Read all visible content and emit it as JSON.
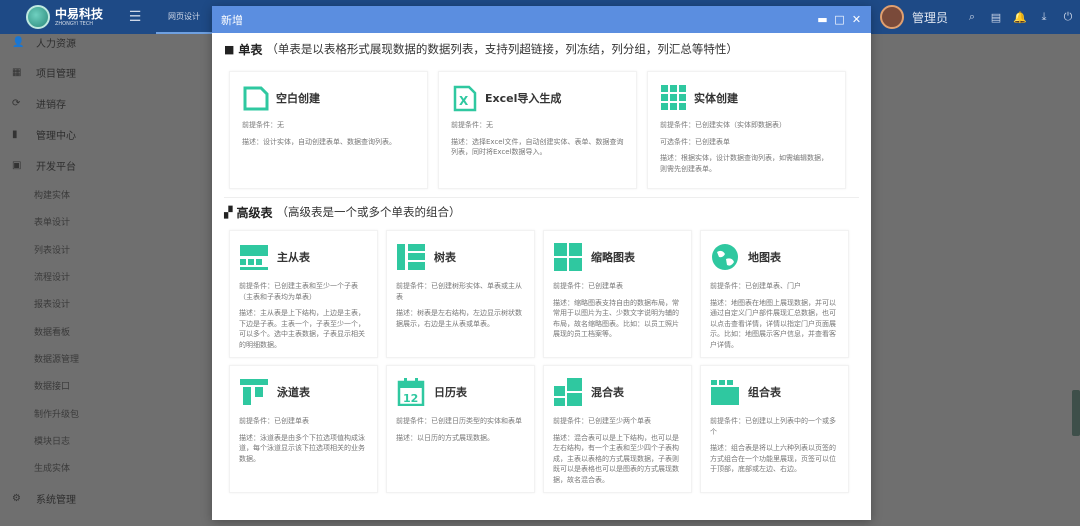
{
  "app": {
    "logo_cn": "中易科技",
    "logo_en": "ZHONGYI TECH",
    "top_tab": "网页设计",
    "username": "管理员"
  },
  "sidebar": {
    "items": [
      {
        "label": "人力资源",
        "icon": "user-icon"
      },
      {
        "label": "项目管理",
        "icon": "calendar-icon"
      },
      {
        "label": "进销存",
        "icon": "refresh-icon"
      },
      {
        "label": "管理中心",
        "icon": "chart-icon"
      },
      {
        "label": "开发平台",
        "icon": "grid-icon"
      }
    ],
    "sub_items": [
      "构建实体",
      "表单设计",
      "列表设计",
      "流程设计",
      "报表设计",
      "数据看板",
      "数据源管理",
      "数据接口",
      "制作升级包",
      "模块日志",
      "生成实体"
    ],
    "bottom_item": {
      "label": "系统管理",
      "icon": "settings-icon"
    }
  },
  "modal": {
    "title": "新增",
    "single_section": {
      "name": "单表",
      "desc": "（单表是以表格形式展现数据的数据列表，支持列超链接，列冻结，列分组，列汇总等特性）",
      "cards": [
        {
          "title": "空白创建",
          "icon": "blank-doc-icon",
          "color": "#2fc8a0",
          "line1": "前提条件：无",
          "line2": "描述：设计实体，自动创建表单、数据查询列表。"
        },
        {
          "title": "Excel导入生成",
          "icon": "excel-icon",
          "color": "#2fc8a0",
          "line1": "前提条件：无",
          "line2": "描述：选择Excel文件，自动创建实体、表单、数据查询列表，同时将Excel数据导入。"
        },
        {
          "title": "实体创建",
          "icon": "table-grid-icon",
          "color": "#2fc8a0",
          "line1": "前提条件：已创建实体（实体即数据表）",
          "line2": "可选条件：已创建表单",
          "line3": "描述：根据实体，设计数据查询列表，如需编辑数据，则需先创建表单。"
        }
      ]
    },
    "advanced_section": {
      "name": "高级表",
      "desc": "（高级表是一个或多个单表的组合）",
      "cards": [
        {
          "title": "主从表",
          "icon": "master-detail-icon",
          "line1": "前提条件：已创建主表和至少一个子表（主表和子表均为单表）",
          "line2": "描述：主从表是上下结构，上边是主表，下边是子表。主表一个，子表至少一个，可以多个。选中主表数据，子表显示相关的明细数据。"
        },
        {
          "title": "树表",
          "icon": "tree-table-icon",
          "line1": "前提条件：已创建树形实体、单表或主从表",
          "line2": "描述：树表是左右结构，左边显示树状数据展示，右边是主从表或单表。"
        },
        {
          "title": "缩略图表",
          "icon": "thumbnail-icon",
          "line1": "前提条件：已创建单表",
          "line2": "描述：缩略图表支持自由的数据布局，常常用于以图片为主、少数文字说明为辅的布局，故名缩略图表。比如：以员工照片展现的员工档案等。"
        },
        {
          "title": "地图表",
          "icon": "map-globe-icon",
          "line1": "前提条件：已创建单表、门户",
          "line2": "描述：地图表在地图上展现数据，并可以通过自定义门户部件展现汇总数据，也可以点击查看详情，详情以指定门户页面展示。比如：地图展示客户信息，并查看客户详情。"
        },
        {
          "title": "泳道表",
          "icon": "swimlane-icon",
          "line1": "前提条件：已创建单表",
          "line2": "描述：泳道表是由多个下拉选项值构成泳道，每个泳道显示该下拉选项相关的业务数据。"
        },
        {
          "title": "日历表",
          "icon": "calendar-12-icon",
          "line1": "前提条件：已创建日历类型的实体和表单",
          "line2": "描述：以日历的方式展现数据。"
        },
        {
          "title": "混合表",
          "icon": "mixed-table-icon",
          "line1": "前提条件：已创建至少两个单表",
          "line2": "描述：混合表可以是上下结构，也可以是左右结构，有一个主表和至少四个子表构成，主表以表格的方式展现数据，子表则既可以是表格也可以是图表的方式展现数据，故名混合表。"
        },
        {
          "title": "组合表",
          "icon": "combo-table-icon",
          "line1": "前提条件：已创建以上列表中的一个或多个",
          "line2": "描述：组合表是将以上六种列表以页签的方式组合在一个功能里展现，页签可以位于顶部，底部或左边、右边。"
        }
      ]
    }
  },
  "colors": {
    "accent": "#2fc8a0",
    "header": "#5b8ee0",
    "topbar": "#1e4a86"
  }
}
